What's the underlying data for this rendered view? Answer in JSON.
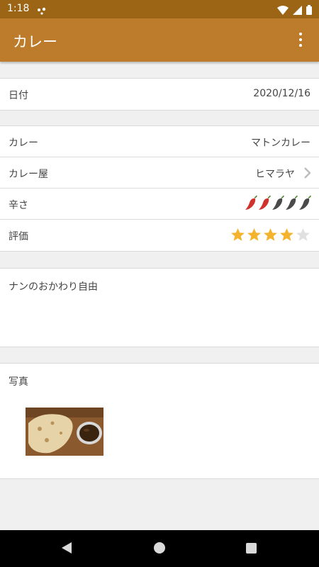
{
  "status_bar": {
    "time": "1:18"
  },
  "app_bar": {
    "title": "カレー"
  },
  "date_section": {
    "label": "日付",
    "value": "2020/12/16"
  },
  "details": {
    "curry": {
      "label": "カレー",
      "value": "マトンカレー"
    },
    "shop": {
      "label": "カレー屋",
      "value": "ヒマラヤ"
    },
    "spiciness": {
      "label": "辛さ",
      "level": 2,
      "max": 5,
      "active_color": "#d0312d",
      "inactive_color": "#4a4a4a"
    },
    "rating": {
      "label": "評価",
      "level": 4,
      "max": 5,
      "active_color": "#f4b32c",
      "inactive_color": "#e0e0e0"
    }
  },
  "memo": {
    "text": "ナンのおかわり自由"
  },
  "photo": {
    "label": "写真"
  },
  "colors": {
    "status_bar": "#9c6516",
    "app_bar": "#bd7c2c"
  }
}
